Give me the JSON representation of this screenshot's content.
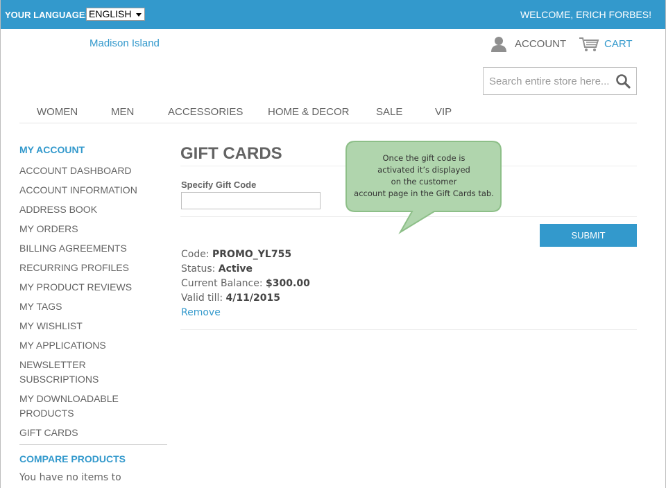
{
  "topbar": {
    "language_label": "YOUR LANGUAGE:",
    "language_value": "ENGLISH",
    "welcome": "WELCOME, ERICH FORBES!"
  },
  "header": {
    "logo": "Madison Island",
    "account_label": "ACCOUNT",
    "cart_label": "CART",
    "search_placeholder": "Search entire store here..."
  },
  "nav": {
    "items": [
      "WOMEN",
      "MEN",
      "ACCESSORIES",
      "HOME & DECOR",
      "SALE",
      "VIP"
    ]
  },
  "sidebar": {
    "title": "MY ACCOUNT",
    "items": [
      "ACCOUNT DASHBOARD",
      "ACCOUNT INFORMATION",
      "ADDRESS BOOK",
      "MY ORDERS",
      "BILLING AGREEMENTS",
      "RECURRING PROFILES",
      "MY PRODUCT REVIEWS",
      "MY TAGS",
      "MY WISHLIST",
      "MY APPLICATIONS",
      "NEWSLETTER SUBSCRIPTIONS",
      "MY DOWNLOADABLE PRODUCTS",
      "GIFT CARDS"
    ],
    "compare_title": "COMPARE PRODUCTS",
    "compare_empty": "You have no items to"
  },
  "main": {
    "title": "GIFT CARDS",
    "field_label": "Specify Gift Code",
    "code_value": "",
    "submit_label": "SUBMIT",
    "card": {
      "code_label": "Code:",
      "code_value": "PROMO_YL755",
      "status_label": "Status:",
      "status_value": "Active",
      "balance_label": "Current Balance:",
      "balance_value": "$300.00",
      "valid_label": "Valid till:",
      "valid_value": "4/11/2015",
      "remove_label": "Remove"
    }
  },
  "tooltip": {
    "lines": [
      "Once the gift code is",
      "activated it’s displayed",
      "on the customer",
      "account page in the Gift Cards tab."
    ]
  },
  "colors": {
    "accent": "#3399cc",
    "text": "#636363",
    "tooltip_fill": "#b0d5ad",
    "tooltip_border": "#8dbf88"
  },
  "icons": {
    "account": "user-icon",
    "cart": "cart-icon",
    "search": "search-icon",
    "language_dropdown": "caret-down-icon"
  }
}
